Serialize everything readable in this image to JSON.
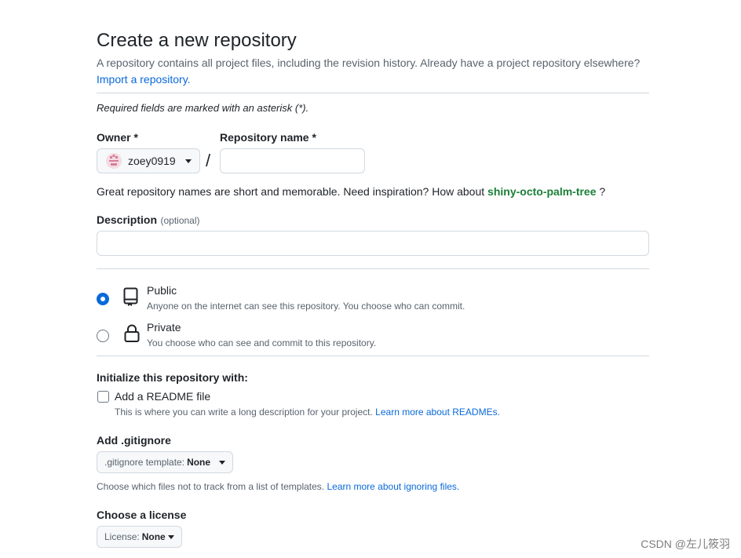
{
  "header": {
    "title": "Create a new repository",
    "intro": "A repository contains all project files, including the revision history. Already have a project repository elsewhere?",
    "import_link": "Import a repository."
  },
  "required_note": "Required fields are marked with an asterisk (*).",
  "owner": {
    "label": "Owner *",
    "value": "zoey0919"
  },
  "separator": "/",
  "repo_name": {
    "label": "Repository name *",
    "value": ""
  },
  "inspiration": {
    "text": "Great repository names are short and memorable. Need inspiration? How about",
    "suggestion": "shiny-octo-palm-tree",
    "suffix": "?"
  },
  "description": {
    "label": "Description",
    "optional": "(optional)",
    "value": ""
  },
  "visibility": {
    "selected": "public",
    "public": {
      "label": "Public",
      "desc": "Anyone on the internet can see this repository. You choose who can commit."
    },
    "private": {
      "label": "Private",
      "desc": "You choose who can see and commit to this repository."
    }
  },
  "init": {
    "heading": "Initialize this repository with:",
    "readme_label": "Add a README file",
    "readme_checked": false,
    "readme_desc": "This is where you can write a long description for your project.",
    "readme_link": "Learn more about READMEs."
  },
  "gitignore": {
    "heading": "Add .gitignore",
    "button_prefix": ".gitignore template:",
    "button_value": "None",
    "desc": "Choose which files not to track from a list of templates.",
    "link": "Learn more about ignoring files."
  },
  "license": {
    "heading": "Choose a license",
    "button_prefix": "License:",
    "button_value": "None"
  },
  "watermark": "CSDN @左儿筱羽",
  "colors": {
    "accent": "#0969da",
    "suggestion": "#1a7f37",
    "border": "#d1d9e0"
  }
}
